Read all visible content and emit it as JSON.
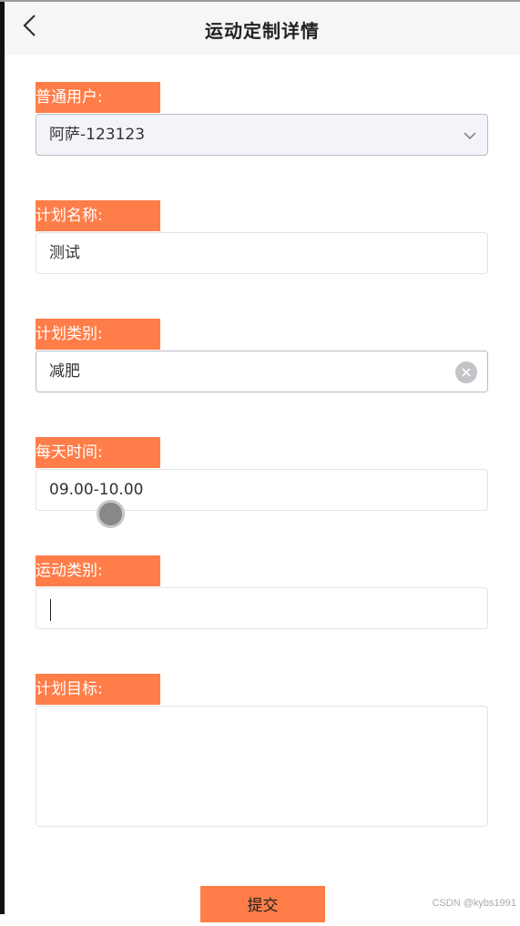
{
  "header": {
    "title": "运动定制详情"
  },
  "form": {
    "user": {
      "label": "普通用户:",
      "value": "阿萨-123123"
    },
    "plan_name": {
      "label": "计划名称:",
      "value": "测试"
    },
    "plan_category": {
      "label": "计划类别:",
      "value": "减肥"
    },
    "daily_time": {
      "label": "每天时间:",
      "value": "09.00-10.00"
    },
    "sport_category": {
      "label": "运动类别:",
      "value": ""
    },
    "plan_goal": {
      "label": "计划目标:",
      "value": ""
    }
  },
  "submit_label": "提交",
  "watermark": "CSDN @kybs1991",
  "colors": {
    "accent": "#ff7d48",
    "header_bg": "#f6f6f6"
  }
}
